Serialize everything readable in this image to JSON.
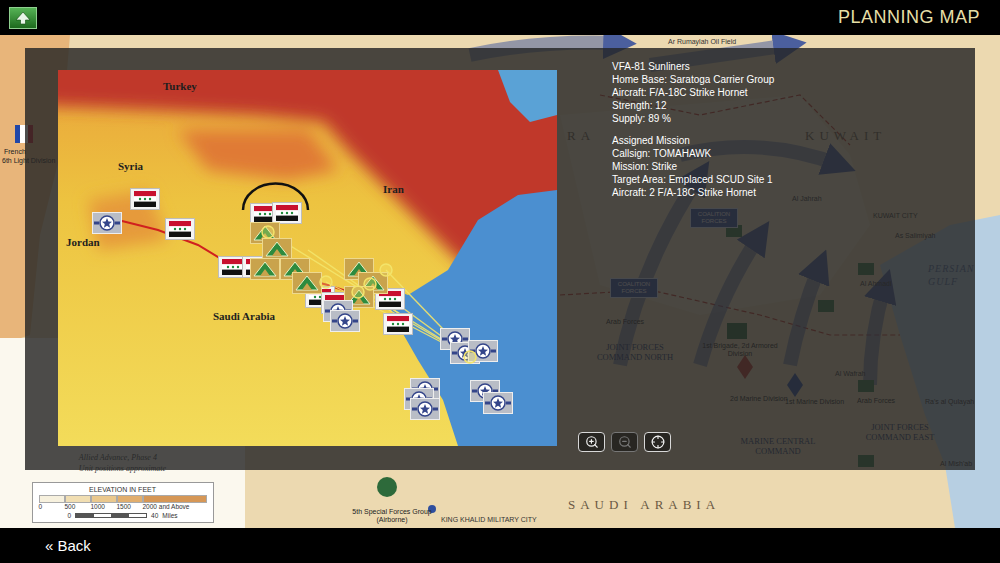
{
  "top_bar": {
    "title": "PLANNING MAP"
  },
  "background_map": {
    "labels": [
      {
        "text": "French",
        "kind": "unit"
      },
      {
        "text": "6th Light Division",
        "kind": "unit"
      },
      {
        "text": "Ar Rumaylah Oil Field",
        "kind": "town"
      },
      {
        "text": "RA",
        "kind": "country"
      },
      {
        "text": "KUWAIT",
        "kind": "country"
      },
      {
        "text": "KUWAIT CITY",
        "kind": "town"
      },
      {
        "text": "Al Jahrah",
        "kind": "town"
      },
      {
        "text": "As Salimiyah",
        "kind": "town"
      },
      {
        "text": "COALITION FORCES",
        "kind": "badge"
      },
      {
        "text": "COALITION FORCES",
        "kind": "badge"
      },
      {
        "text": "Al Ahmadi",
        "kind": "town"
      },
      {
        "text": "PERSIAN GULF",
        "kind": "sea"
      },
      {
        "text": "Arab Forces",
        "kind": "unit"
      },
      {
        "text": "JOINT FORCES COMMAND NORTH",
        "kind": "command"
      },
      {
        "text": "1st Brigade, 2d Armored Division",
        "kind": "unit"
      },
      {
        "text": "2d Marine Division",
        "kind": "unit"
      },
      {
        "text": "1st Marine Division",
        "kind": "unit"
      },
      {
        "text": "Al Wafrah",
        "kind": "town"
      },
      {
        "text": "Arab Forces",
        "kind": "unit"
      },
      {
        "text": "Ra's al Qulayah",
        "kind": "town"
      },
      {
        "text": "JOINT FORCES COMMAND EAST",
        "kind": "command"
      },
      {
        "text": "MARINE CENTRAL COMMAND",
        "kind": "command"
      },
      {
        "text": "Al Mish'ab",
        "kind": "town"
      },
      {
        "text": "SAUDI ARABIA",
        "kind": "country"
      },
      {
        "text": "5th Special Forces Group (Airborne)",
        "kind": "unit"
      },
      {
        "text": "KING KHALID MILITARY CITY",
        "kind": "town"
      }
    ]
  },
  "legend": {
    "notes": [
      "Allied Advance, Phase 4",
      "Unit positions approximate"
    ],
    "title": "ELEVATION IN FEET",
    "steps": [
      {
        "label": "0",
        "color": "#f7f1de"
      },
      {
        "label": "500",
        "color": "#f1deb2"
      },
      {
        "label": "1000",
        "color": "#eac88e"
      },
      {
        "label": "1500",
        "color": "#e1ae6e"
      },
      {
        "label": "2000 and Above",
        "color": "#d69756"
      }
    ],
    "scale": {
      "ticks": [
        "0",
        "40"
      ],
      "unit": "Miles"
    }
  },
  "planning_panel": {
    "map": {
      "labels": [
        "Turkey",
        "Syria",
        "Iran",
        "Jordan",
        "Saudi Arabia"
      ],
      "units": [
        {
          "kind": "iraqi"
        },
        {
          "kind": "iraqi"
        },
        {
          "kind": "iraqi"
        },
        {
          "kind": "iraqi"
        },
        {
          "kind": "iraqi"
        },
        {
          "kind": "iraqi"
        },
        {
          "kind": "iraqi"
        },
        {
          "kind": "iraqi"
        },
        {
          "kind": "iraqi"
        },
        {
          "kind": "iraqi"
        },
        {
          "kind": "armor"
        },
        {
          "kind": "armor"
        },
        {
          "kind": "armor"
        },
        {
          "kind": "armor"
        },
        {
          "kind": "armor"
        },
        {
          "kind": "armor"
        },
        {
          "kind": "armor"
        },
        {
          "kind": "armor"
        },
        {
          "kind": "navy"
        },
        {
          "kind": "navy"
        },
        {
          "kind": "navy"
        },
        {
          "kind": "navy"
        },
        {
          "kind": "navy"
        },
        {
          "kind": "navy"
        },
        {
          "kind": "navy"
        },
        {
          "kind": "navy"
        },
        {
          "kind": "navy"
        },
        {
          "kind": "navy"
        },
        {
          "kind": "navy"
        }
      ]
    },
    "unit_info": {
      "lines": [
        "VFA-81 Sunliners",
        "Home Base: Saratoga Carrier Group",
        "Aircraft: F/A-18C Strike Hornet",
        "Strength: 12",
        "Supply: 89 %"
      ]
    },
    "mission": {
      "title": "Assigned Mission",
      "lines": [
        "Callsign: TOMAHAWK",
        "Mission: Strike",
        "Target Area: Emplaced SCUD Site 1",
        "Aircraft: 2 F/A-18C Strike Hornet"
      ]
    },
    "zoom_buttons": [
      {
        "kind": "zoom-in",
        "disabled": false
      },
      {
        "kind": "zoom-out",
        "disabled": true
      },
      {
        "kind": "center",
        "disabled": false
      }
    ]
  },
  "bottom_bar": {
    "back": "« Back"
  }
}
